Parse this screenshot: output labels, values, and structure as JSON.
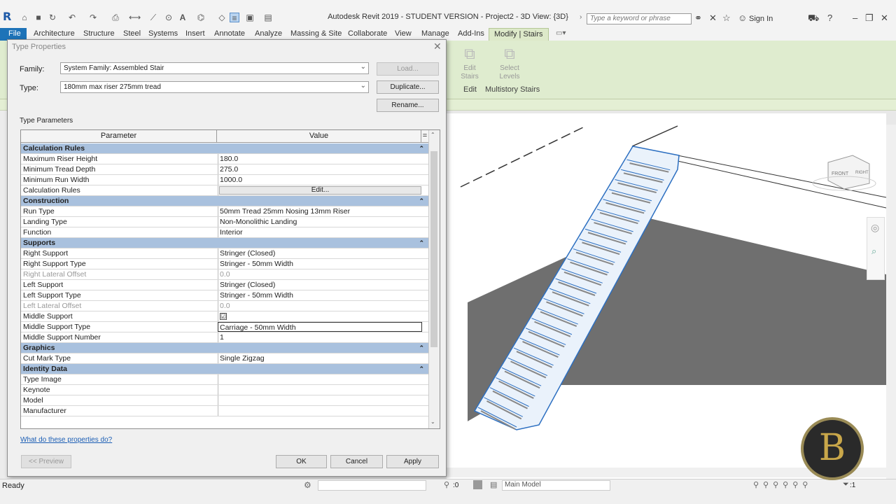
{
  "app": {
    "logo": "R",
    "title": "Autodesk Revit 2019 - STUDENT VERSION - Project2 - 3D View: {3D}",
    "search_placeholder": "Type a keyword or phrase",
    "sign_in": "Sign In"
  },
  "ribbon": {
    "tabs": [
      "File",
      "Architecture",
      "Structure",
      "Steel",
      "Systems",
      "Insert",
      "Annotate",
      "Analyze",
      "Massing & Site",
      "Collaborate",
      "View",
      "Manage",
      "Add-Ins",
      "Modify | Stairs"
    ],
    "active_tab": "Modify | Stairs",
    "buttons": [
      {
        "label": "Edit Stairs",
        "l1": "Edit",
        "l2": "Stairs"
      },
      {
        "label": "Select Levels",
        "l1": "Select",
        "l2": "Levels"
      }
    ],
    "groups": [
      "Edit",
      "Multistory Stairs"
    ]
  },
  "dialog": {
    "title": "Type Properties",
    "family_label": "Family:",
    "family_value": "System Family: Assembled Stair",
    "type_label": "Type:",
    "type_value": "180mm max riser 275mm tread",
    "load_button": "Load...",
    "duplicate_button": "Duplicate...",
    "rename_button": "Rename...",
    "section_label": "Type Parameters",
    "col_parameter": "Parameter",
    "col_value": "Value",
    "col_eq": "=",
    "edit_button": "Edit...",
    "help_link": "What do these properties do?",
    "preview_button": "<< Preview",
    "ok_button": "OK",
    "cancel_button": "Cancel",
    "apply_button": "Apply"
  },
  "parameters": {
    "calculation_rules": {
      "title": "Calculation Rules",
      "rows": [
        {
          "p": "Maximum Riser Height",
          "v": "180.0"
        },
        {
          "p": "Minimum Tread Depth",
          "v": "275.0"
        },
        {
          "p": "Minimum Run Width",
          "v": "1000.0"
        },
        {
          "p": "Calculation Rules",
          "v": ""
        }
      ]
    },
    "construction": {
      "title": "Construction",
      "rows": [
        {
          "p": "Run Type",
          "v": "50mm Tread 25mm Nosing 13mm Riser"
        },
        {
          "p": "Landing Type",
          "v": "Non-Monolithic Landing"
        },
        {
          "p": "Function",
          "v": "Interior"
        }
      ]
    },
    "supports": {
      "title": "Supports",
      "rows": [
        {
          "p": "Right Support",
          "v": "Stringer (Closed)"
        },
        {
          "p": "Right Support Type",
          "v": "Stringer - 50mm Width"
        },
        {
          "p": "Right Lateral Offset",
          "v": "0.0"
        },
        {
          "p": "Left Support",
          "v": "Stringer (Closed)"
        },
        {
          "p": "Left Support Type",
          "v": "Stringer - 50mm Width"
        },
        {
          "p": "Left Lateral Offset",
          "v": "0.0"
        },
        {
          "p": "Middle Support",
          "v": "☑"
        },
        {
          "p": "Middle Support Type",
          "v": "Carriage - 50mm Width"
        },
        {
          "p": "Middle Support Number",
          "v": "1"
        }
      ]
    },
    "graphics": {
      "title": "Graphics",
      "rows": [
        {
          "p": "Cut Mark Type",
          "v": "Single Zigzag"
        }
      ]
    },
    "identity_data": {
      "title": "Identity Data",
      "rows": [
        {
          "p": "Type Image",
          "v": ""
        },
        {
          "p": "Keynote",
          "v": ""
        },
        {
          "p": "Model",
          "v": ""
        },
        {
          "p": "Manufacturer",
          "v": ""
        }
      ]
    }
  },
  "view": {
    "viewcube_front": "FRONT",
    "viewcube_right": "RIGHT"
  },
  "statusbar": {
    "text": "Ready",
    "count": ":0",
    "model": "Main Model",
    "filter": ":1"
  },
  "colors": {
    "accent": "#1d73b8",
    "group_header": "#a9c1de",
    "ribbon_context": "#dfeccf"
  },
  "watermark": "B"
}
